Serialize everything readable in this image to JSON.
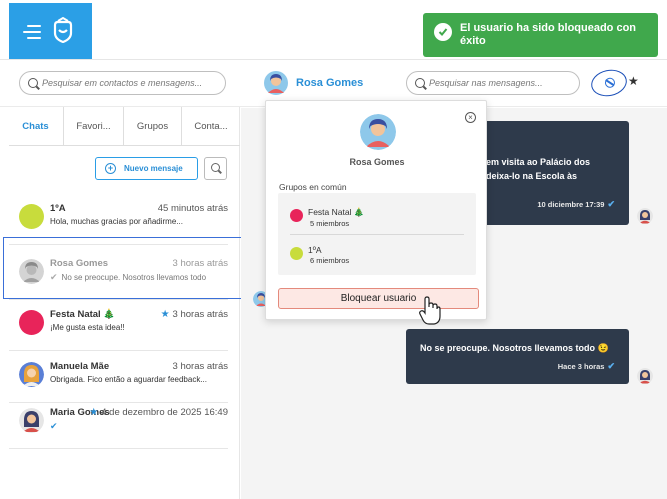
{
  "toast": {
    "message": "El usuario ha sido bloqueado con éxito"
  },
  "search": {
    "contacts_placeholder": "Pesquisar em contactos e mensagens...",
    "messages_placeholder": "Pesquisar nas mensagens..."
  },
  "header": {
    "contact_name": "Rosa Gomes"
  },
  "tabs": [
    {
      "label": "Chats",
      "active": true
    },
    {
      "label": "Favori..."
    },
    {
      "label": "Grupos"
    },
    {
      "label": "Conta..."
    }
  ],
  "new_message_label": "Nuevo mensaje",
  "chats": [
    {
      "name": "1ºA",
      "time": "45 minutos atrás",
      "message": "Hola, muchas gracias por añadirme...",
      "avatar_color": "#c8dc3c"
    },
    {
      "name": "Rosa Gomes",
      "time": "3 horas atrás",
      "message": "No se preocupe. Nosotros llevamos todo",
      "avatar_color": "#bdbdbd"
    },
    {
      "name": "Festa Natal",
      "name_emoji": "🎄",
      "time": "3 horas atrás",
      "message": "¡Me gusta esta idea!!",
      "avatar_color": "#e8245a"
    },
    {
      "name": "Manuela Mãe",
      "time": "3 horas atrás",
      "message": "Obrigada. Fico então a aguardar feedback...",
      "avatar_color": "#f0a23c"
    },
    {
      "name": "Maria Gomes",
      "time": "4 de dezembro de 2025 16:49",
      "message": "",
      "avatar_color": "#5a7fd6"
    }
  ],
  "popup": {
    "contact_name": "Rosa Gomes",
    "groups_title": "Grupos en común",
    "groups": [
      {
        "name": "Festa Natal",
        "emoji": "🎄",
        "members": "5 miembros",
        "color": "#e8245a"
      },
      {
        "name": "1ºA",
        "members": "6 miembros",
        "color": "#c8dc3c"
      }
    ],
    "block_label": "Bloquear usuario"
  },
  "messages": [
    {
      "text_line1": "em visita ao Palácio dos",
      "text_line2": "deixa-lo na Escola às",
      "time": "10 diciembre 17:39"
    },
    {
      "text": "No se preocupe. Nosotros llevamos todo",
      "emoji": "😉",
      "time": "Hace 3 horas"
    }
  ],
  "colors": {
    "accent": "#2a8fd6",
    "brand": "#2b9fe6",
    "toast": "#40a84c",
    "bubble": "#2e3a4b"
  }
}
